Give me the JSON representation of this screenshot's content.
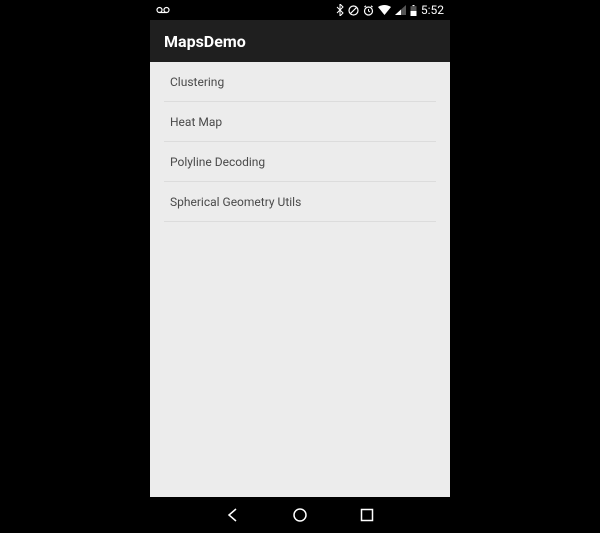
{
  "status": {
    "time": "5:52"
  },
  "app": {
    "title": "MapsDemo"
  },
  "list": {
    "items": [
      {
        "label": "Clustering"
      },
      {
        "label": "Heat Map"
      },
      {
        "label": "Polyline Decoding"
      },
      {
        "label": "Spherical Geometry Utils"
      }
    ]
  }
}
